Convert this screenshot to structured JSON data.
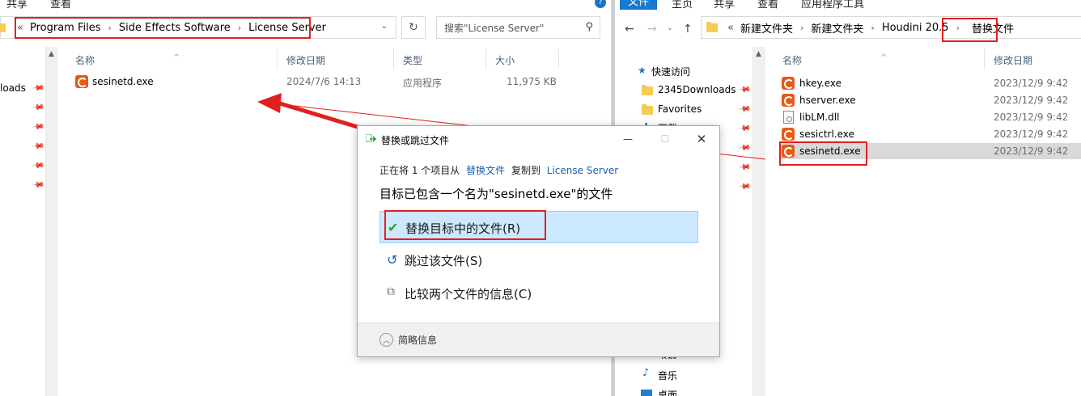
{
  "left": {
    "ribbon": {
      "tab_share": "共享",
      "tab_view": "查看"
    },
    "breadcrumb": [
      "Program Files",
      "Side Effects Software",
      "License Server"
    ],
    "breadcrumb_prefix": "«",
    "search_placeholder": "搜索\"License Server\"",
    "nav_fragment": "loads",
    "columns": {
      "name": "名称",
      "modified": "修改日期",
      "type": "类型",
      "size": "大小"
    },
    "files": [
      {
        "name": "sesinetd.exe",
        "modified": "2024/7/6 14:13",
        "type": "应用程序",
        "size": "11,975 KB"
      }
    ]
  },
  "right": {
    "ribbon": {
      "tab_file": "文件",
      "tab_home": "主页",
      "tab_share": "共享",
      "tab_view": "查看",
      "tab_tools": "应用程序工具"
    },
    "breadcrumb_prefix": "«",
    "breadcrumb": [
      "新建文件夹",
      "新建文件夹",
      "Houdini 20.5",
      "替换文件"
    ],
    "nav": {
      "quick_access": "快速访问",
      "items": [
        "2345Downloads",
        "Favorites",
        "下载"
      ],
      "bottom_items": [
        "下载",
        "音乐",
        "桌面"
      ]
    },
    "columns": {
      "name": "名称",
      "modified": "修改日期"
    },
    "files": [
      {
        "name": "hkey.exe",
        "modified": "2023/12/9 9:42",
        "icon": "houdini-icon"
      },
      {
        "name": "hserver.exe",
        "modified": "2023/12/9 9:42",
        "icon": "houdini-icon"
      },
      {
        "name": "libLM.dll",
        "modified": "2023/12/9 9:42",
        "icon": "dll-icon"
      },
      {
        "name": "sesictrl.exe",
        "modified": "2023/12/9 9:42",
        "icon": "houdini-icon"
      },
      {
        "name": "sesinetd.exe",
        "modified": "2023/12/9 9:42",
        "icon": "houdini-icon",
        "selected": true
      }
    ]
  },
  "dialog": {
    "title": "替换或跳过文件",
    "progress_prefix": "正在将 1 个项目从",
    "progress_source": "替换文件",
    "progress_mid": "复制到",
    "progress_target": "License Server",
    "message": "目标已包含一个名为\"sesinetd.exe\"的文件",
    "option_replace": "替换目标中的文件(R)",
    "option_skip": "跳过该文件(S)",
    "option_compare": "比较两个文件的信息(C)",
    "details": "简略信息"
  },
  "colors": {
    "highlight_red": "#e0201f",
    "selection_blue": "#cce8ff",
    "houdini_orange": "#e55b18",
    "check_green": "#2aa52a"
  }
}
